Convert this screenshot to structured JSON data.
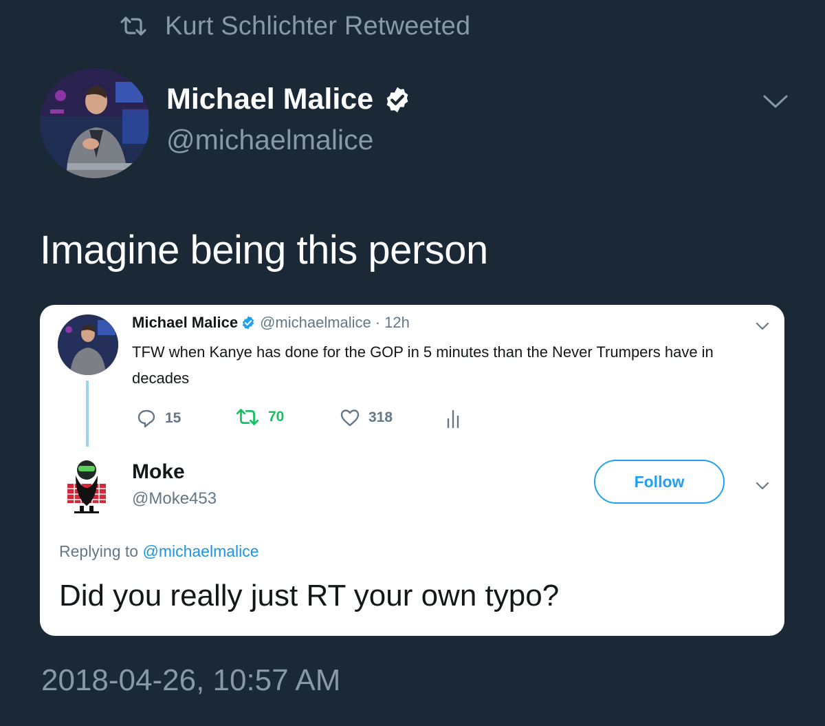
{
  "retweet_header": {
    "icon": "retweet-icon",
    "text": "Kurt Schlichter Retweeted"
  },
  "tweet": {
    "author": {
      "name": "Michael Malice",
      "handle": "@michaelmalice",
      "verified": true
    },
    "text": "Imagine being this person",
    "timestamp": "2018-04-26, 10:57 AM"
  },
  "quoted": {
    "original": {
      "name": "Michael Malice",
      "handle": "@michaelmalice",
      "separator": "·",
      "time": "12h",
      "text": "TFW when Kanye has done for the GOP in 5 minutes than the Never Trumpers have in decades",
      "actions": {
        "replies": "15",
        "retweets": "70",
        "likes": "318"
      }
    },
    "reply": {
      "name": "Moke",
      "handle": "@Moke453",
      "follow_label": "Follow",
      "replying_prefix": "Replying to",
      "replying_mention": "@michaelmalice",
      "text": "Did you really just RT your own typo?"
    }
  },
  "colors": {
    "background": "#1b2836",
    "muted": "#8899a6",
    "accent": "#1da1f2",
    "retweet_green": "#17bf63"
  }
}
